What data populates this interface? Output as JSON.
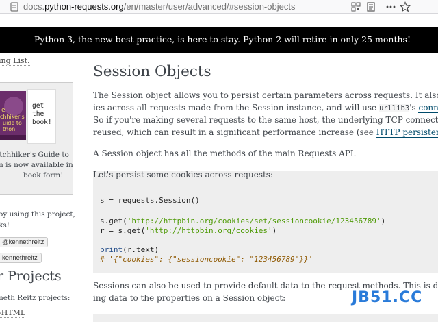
{
  "browser": {
    "url_prefix": "docs.",
    "url_domain": "python-requests.org",
    "url_path": "/en/master/user/advanced/#session-objects"
  },
  "banner": {
    "text": "Python 3, the new best practice, is here to stay. Python 2 will retire in only 25 months!"
  },
  "sidebar": {
    "mailing_list": "ing List.",
    "book_cover_title": "e\nchhiker's\nuide to\nthon",
    "get_book": "get\nthe\nbook!",
    "book_line1": "itchhiker's Guide to",
    "book_line2": "n is now available in",
    "book_line3": "book form!",
    "enjoy_line1": "oy using this project,",
    "enjoy_line2": "ks!",
    "follow_label": "@kennethreitz",
    "twitter_link": "kennethreitz",
    "projects_heading": "r Projects",
    "other_projects": "neth Reitz projects:",
    "project_1": "-HTML"
  },
  "main": {
    "title": "Session Objects",
    "intro_line1": "The Session object allows you to persist certain parameters across requests. It also persists",
    "intro_line2_a": "ies across all requests made from the Session instance, and will use ",
    "intro_line2_code": "urllib3",
    "intro_line2_b": "'s ",
    "intro_line2_link": "connection p",
    "intro_line3": "So if you're making several requests to the same host, the underlying TCP connection will b",
    "intro_line4_a": "reused, which can result in a significant performance increase (see ",
    "intro_line4_link": "HTTP persistent conne",
    "methods": "A Session object has all the methods of the main Requests API.",
    "persist": "Let's persist some cookies across requests:",
    "code": {
      "l1_a": "s = requests.Session()",
      "l2_a": "s.get(",
      "l2_str": "'http://httpbin.org/cookies/set/sessioncookie/123456789'",
      "l2_b": ")",
      "l3_a": "r = s.get(",
      "l3_str": "'http://httpbin.org/cookies'",
      "l3_b": ")",
      "l4_kw": "print",
      "l4_b": "(r.text)",
      "l5_cmt": "# '{\"cookies\": {\"sessioncookie\": \"123456789\"}}'"
    },
    "defaults_line1": "Sessions can also be used to provide default data to the request methods. This is done by p",
    "defaults_line2": "ing data to the properties on a Session object:"
  },
  "watermark": "JB51.CC"
}
